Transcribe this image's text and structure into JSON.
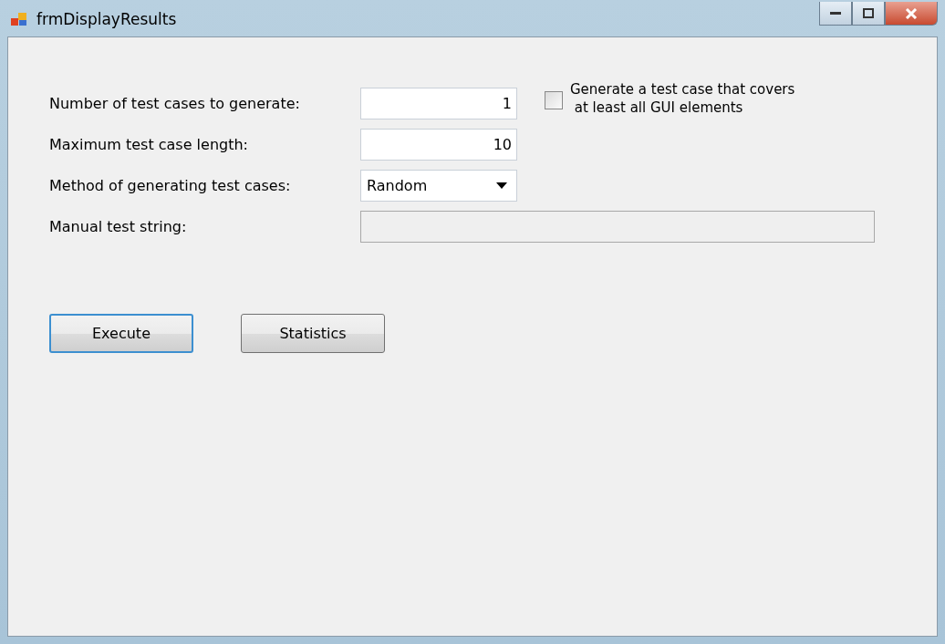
{
  "window": {
    "title": "frmDisplayResults"
  },
  "fields": [
    {
      "kind": "text",
      "label": "Number of test cases to generate:",
      "value": "1",
      "disabled": false
    },
    {
      "kind": "text",
      "label": "Maximum test case length:",
      "value": "10",
      "disabled": false
    },
    {
      "kind": "dropdown",
      "label": "Method of generating test cases:",
      "value": "Random",
      "disabled": false
    },
    {
      "kind": "wide",
      "label": "Manual test string:",
      "disabled": true
    }
  ],
  "checkbox": {
    "label": "Generate a test case that covers\n at least all GUI elements",
    "checked": false
  },
  "buttons": [
    {
      "label": "Execute",
      "focused": true
    },
    {
      "label": "Statistics",
      "focused": false
    }
  ]
}
